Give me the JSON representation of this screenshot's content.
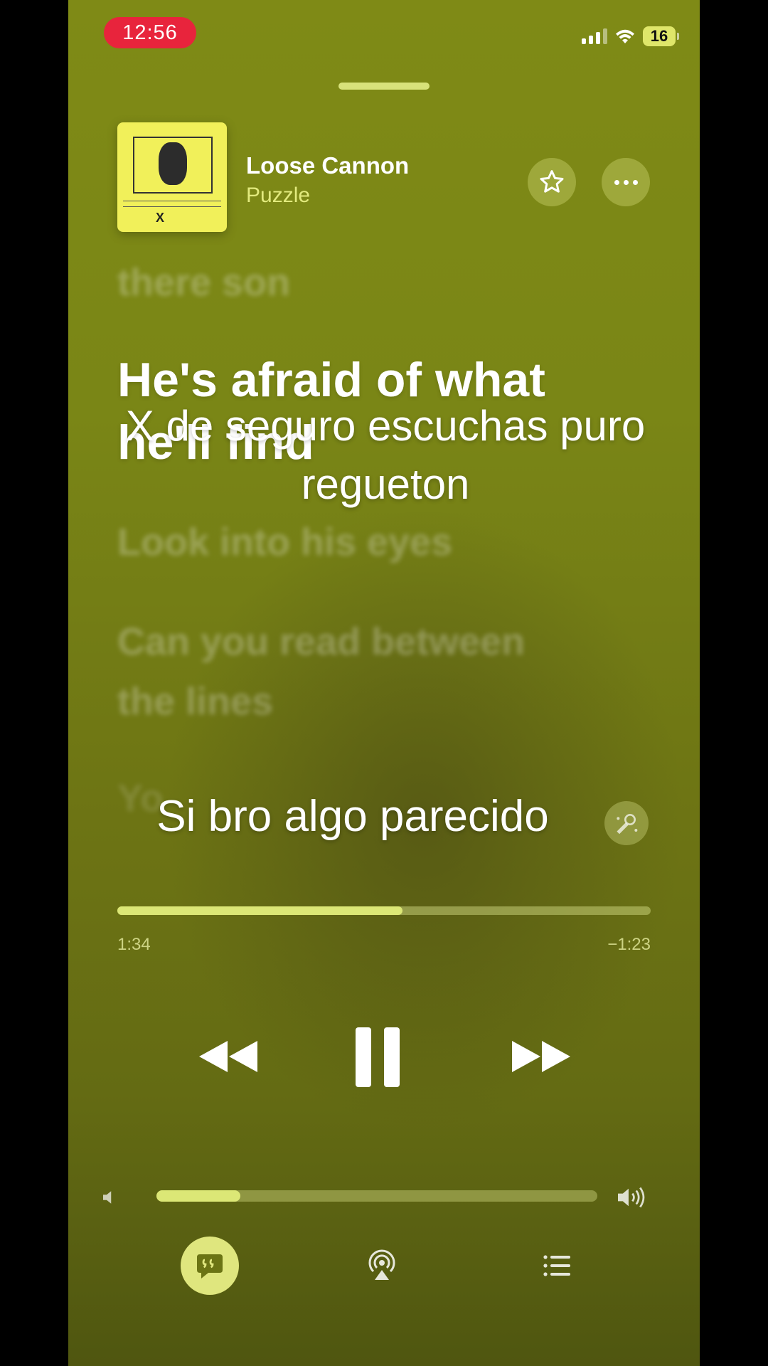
{
  "status_bar": {
    "time": "12:56",
    "battery": "16"
  },
  "now_playing": {
    "title": "Loose Cannon",
    "artist": "Puzzle"
  },
  "lyrics": {
    "previous": "there son",
    "current": "He's afraid of what he'll find",
    "next": [
      "Look into his eyes",
      "Can you read between the lines",
      "Yo"
    ]
  },
  "overlays": {
    "comment": "X de seguro escuchas puro regueton",
    "caption": "Si bro algo parecido"
  },
  "playback": {
    "elapsed": "1:34",
    "remaining": "−1:23",
    "progress_fraction": 0.535
  },
  "volume": {
    "level_fraction": 0.19
  },
  "icons": {
    "favorite": "star-icon",
    "more": "ellipsis-icon",
    "sing": "microphone-sparkle-icon",
    "rewind": "rewind-icon",
    "pause": "pause-icon",
    "forward": "fast-forward-icon",
    "volume_low": "speaker-icon",
    "volume_high": "speaker-wave-icon",
    "lyrics": "quote-bubble-icon",
    "airplay": "airplay-icon",
    "queue": "list-icon"
  },
  "colors": {
    "background_top": "#7f8a16",
    "background_bottom": "#4f5610",
    "accent": "#dce776",
    "time_pill": "#e8243c"
  }
}
